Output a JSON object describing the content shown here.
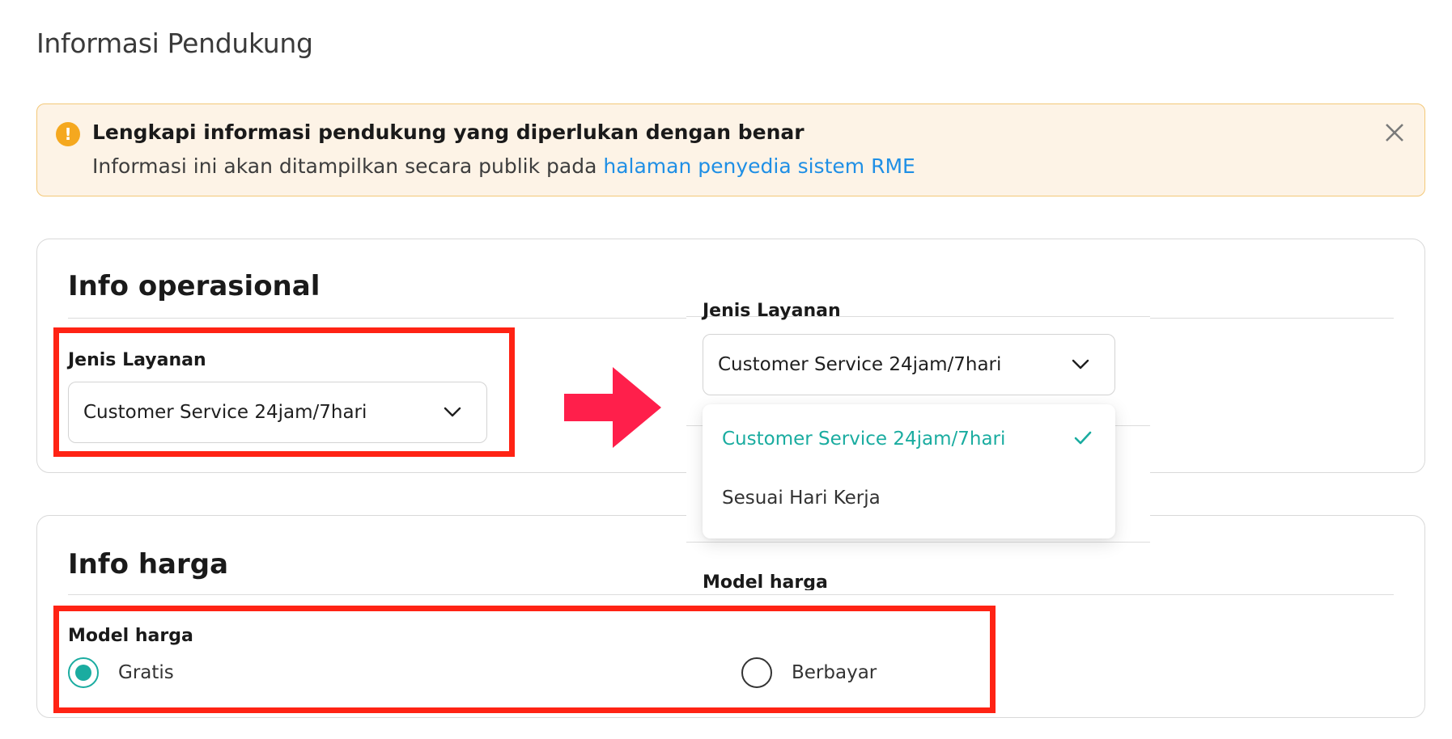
{
  "page": {
    "title": "Informasi Pendukung"
  },
  "alert": {
    "icon": "warning-icon",
    "title": "Lengkapi informasi pendukung yang diperlukan dengan benar",
    "desc_prefix": "Informasi ini akan ditampilkan secara publik pada ",
    "link_text": "halaman penyedia sistem RME",
    "close_icon": "close-icon",
    "colors": {
      "background": "#fdf3e6",
      "border": "#f3c878",
      "icon": "#f5a81f",
      "link": "#1f8fe5"
    }
  },
  "ops_card": {
    "title": "Info operasional",
    "field_label": "Jenis Layanan",
    "selected_value": "Customer Service 24jam/7hari"
  },
  "zoom_snippet": {
    "field_label": "Jenis Layanan",
    "selected_value": "Customer Service 24jam/7hari",
    "options": [
      {
        "label": "Customer Service 24jam/7hari",
        "selected": true
      },
      {
        "label": "Sesuai Hari Kerja",
        "selected": false
      }
    ],
    "cutoff_label": "Model harga"
  },
  "price_card": {
    "title": "Info harga",
    "field_label": "Model harga",
    "options": [
      {
        "label": "Gratis",
        "checked": true
      },
      {
        "label": "Berbayar",
        "checked": false
      }
    ]
  },
  "colors": {
    "accent": "#1aaca0",
    "highlight": "#ff2314",
    "arrow": "#ff1f4b"
  }
}
